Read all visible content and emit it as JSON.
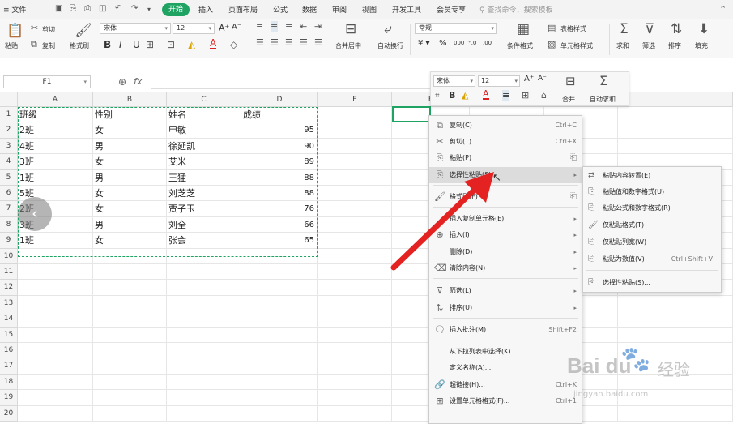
{
  "menubar": {
    "file": "≡ 文件",
    "tabs": [
      {
        "label": "开始",
        "active": true
      },
      {
        "label": "插入"
      },
      {
        "label": "页面布局"
      },
      {
        "label": "公式"
      },
      {
        "label": "数据"
      },
      {
        "label": "审阅"
      },
      {
        "label": "视图"
      },
      {
        "label": "开发工具"
      },
      {
        "label": "会员专享"
      }
    ],
    "search": "查找命令、搜索模板"
  },
  "ribbon": {
    "paste": "粘贴",
    "cut": "剪切",
    "copy": "复制",
    "format_painter": "格式刷",
    "font_name": "宋体",
    "font_size": "12",
    "merge_center": "合并居中",
    "wrap_text": "自动换行",
    "number_format": "常规",
    "conditional_format": "条件格式",
    "table_style": "表格样式",
    "cell_style": "单元格样式",
    "sum": "求和",
    "filter": "筛选",
    "sort": "排序",
    "fill": "填充"
  },
  "formula_bar": {
    "name_box": "F1",
    "fx": "fx"
  },
  "grid": {
    "columns": [
      "A",
      "B",
      "C",
      "D",
      "E",
      "F",
      "G",
      "H",
      "I"
    ],
    "rows": [
      "1",
      "2",
      "3",
      "4",
      "5",
      "6",
      "7",
      "8",
      "9",
      "10",
      "11",
      "12",
      "13",
      "14",
      "15",
      "16",
      "17",
      "18",
      "19",
      "20"
    ],
    "header": [
      "班级",
      "性别",
      "姓名",
      "成绩"
    ],
    "records": [
      [
        "2班",
        "女",
        "申敏",
        "95"
      ],
      [
        "4班",
        "男",
        "徐延凯",
        "90"
      ],
      [
        "3班",
        "女",
        "艾米",
        "89"
      ],
      [
        "1班",
        "男",
        "王猛",
        "88"
      ],
      [
        "5班",
        "女",
        "刘芝芝",
        "88"
      ],
      [
        "2班",
        "女",
        "贾子玉",
        "76"
      ],
      [
        "3班",
        "男",
        "刘全",
        "66"
      ],
      [
        "1班",
        "女",
        "张会",
        "65"
      ]
    ]
  },
  "mini_toolbar": {
    "font_name": "宋体",
    "font_size": "12",
    "merge": "合并",
    "autosum": "自动求和"
  },
  "context_menu": {
    "items": [
      {
        "label": "复制(C)",
        "shortcut": "Ctrl+C"
      },
      {
        "label": "剪切(T)",
        "shortcut": "Ctrl+X"
      },
      {
        "label": "粘贴(P)",
        "shortcut": ""
      },
      {
        "label": "选择性粘贴(S)...",
        "shortcut": "",
        "highlight": true
      },
      {
        "label": "格式刷(F)",
        "shortcut": ""
      },
      {
        "label": "插入复制单元格(E)",
        "shortcut": ""
      },
      {
        "label": "插入(I)",
        "shortcut": ""
      },
      {
        "label": "删除(D)",
        "shortcut": ""
      },
      {
        "label": "清除内容(N)",
        "shortcut": ""
      },
      {
        "label": "筛选(L)",
        "shortcut": ""
      },
      {
        "label": "排序(U)",
        "shortcut": ""
      },
      {
        "label": "插入批注(M)",
        "shortcut": "Shift+F2"
      },
      {
        "label": "从下拉列表中选择(K)...",
        "shortcut": ""
      },
      {
        "label": "定义名称(A)...",
        "shortcut": ""
      },
      {
        "label": "超链接(H)...",
        "shortcut": "Ctrl+K"
      },
      {
        "label": "设置单元格格式(F)...",
        "shortcut": "Ctrl+1"
      }
    ]
  },
  "submenu": {
    "items": [
      {
        "label": "粘贴内容转置(E)",
        "shortcut": ""
      },
      {
        "label": "粘贴值和数字格式(U)",
        "shortcut": ""
      },
      {
        "label": "粘贴公式和数字格式(R)",
        "shortcut": ""
      },
      {
        "label": "仅粘贴格式(T)",
        "shortcut": ""
      },
      {
        "label": "仅粘贴列宽(W)",
        "shortcut": ""
      },
      {
        "label": "粘贴为数值(V)",
        "shortcut": "Ctrl+Shift+V"
      },
      {
        "label": "选择性粘贴(S)...",
        "shortcut": ""
      }
    ]
  },
  "watermark": {
    "logo": "Bai du",
    "cn": "经验",
    "url": "jingyan.baidu.com"
  },
  "colors": {
    "accent": "#1ea363",
    "arrow": "#e52222"
  }
}
